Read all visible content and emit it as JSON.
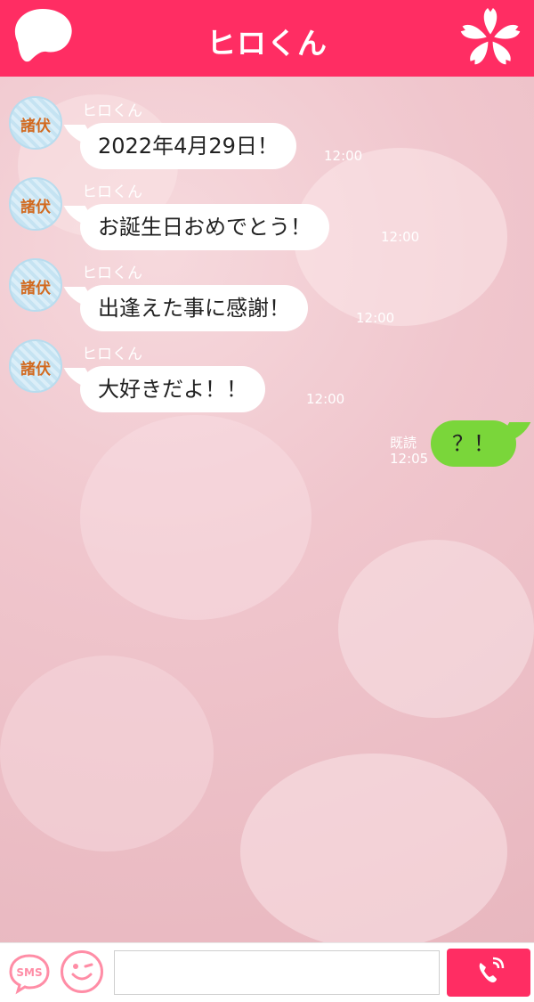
{
  "header": {
    "title": "ヒロくん",
    "accent_color": "#ff2d63"
  },
  "messages": [
    {
      "sender": "ヒロくん",
      "avatar_text": "諸伏",
      "text": "2022年4月29日！",
      "time": "12:00"
    },
    {
      "sender": "ヒロくん",
      "avatar_text": "諸伏",
      "text": "お誕生日おめでとう！",
      "time": "12:00"
    },
    {
      "sender": "ヒロくん",
      "avatar_text": "諸伏",
      "text": "出逢えた事に感謝！",
      "time": "12:00"
    },
    {
      "sender": "ヒロくん",
      "avatar_text": "諸伏",
      "text": "大好きだよ！！",
      "time": "12:00"
    }
  ],
  "outgoing": {
    "text": "？！",
    "read_label": "既読",
    "time": "12:05",
    "bubble_color": "#7ad63a"
  },
  "composer": {
    "sms_label": "SMS",
    "input_value": "",
    "icons": [
      "sms-icon",
      "smile-icon",
      "phone-icon"
    ]
  }
}
